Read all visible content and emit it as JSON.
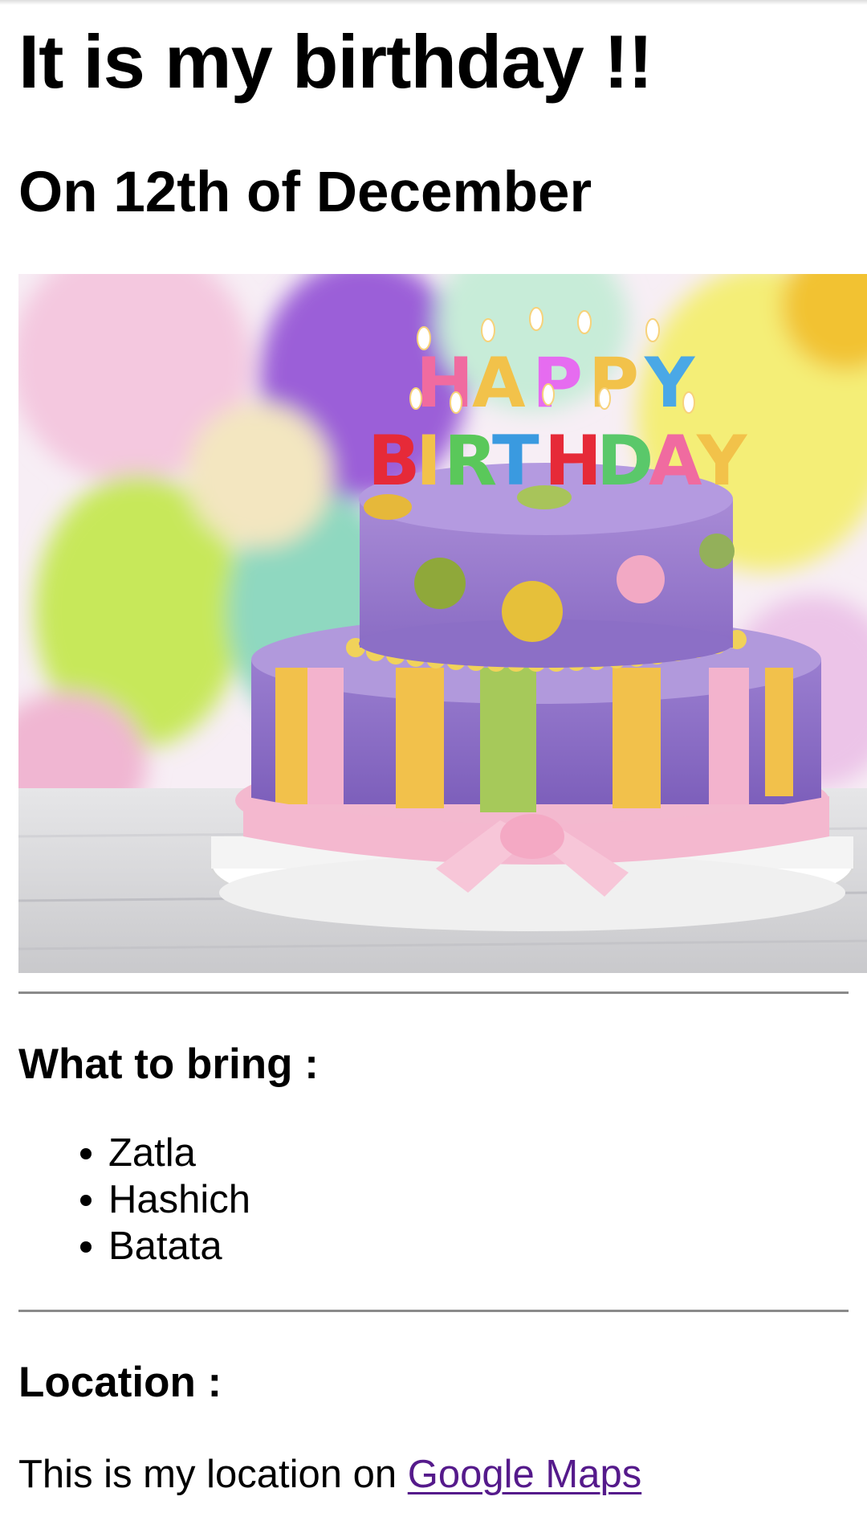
{
  "page": {
    "title": "It is my birthday !!",
    "subtitle": "On 12th of December",
    "image": {
      "alt": "Birthday cake",
      "candle_letters_top": "HAPPY",
      "candle_letters_bottom": "BIRTHDAY"
    }
  },
  "bring": {
    "heading": "What to bring :",
    "items": [
      "Zatla",
      "Hashich",
      "Batata"
    ]
  },
  "location": {
    "heading": "Location :",
    "text": "This is my location on ",
    "link_label": "Google Maps"
  },
  "colors": {
    "link": "#551a8b",
    "divider": "#8a8a8a"
  }
}
